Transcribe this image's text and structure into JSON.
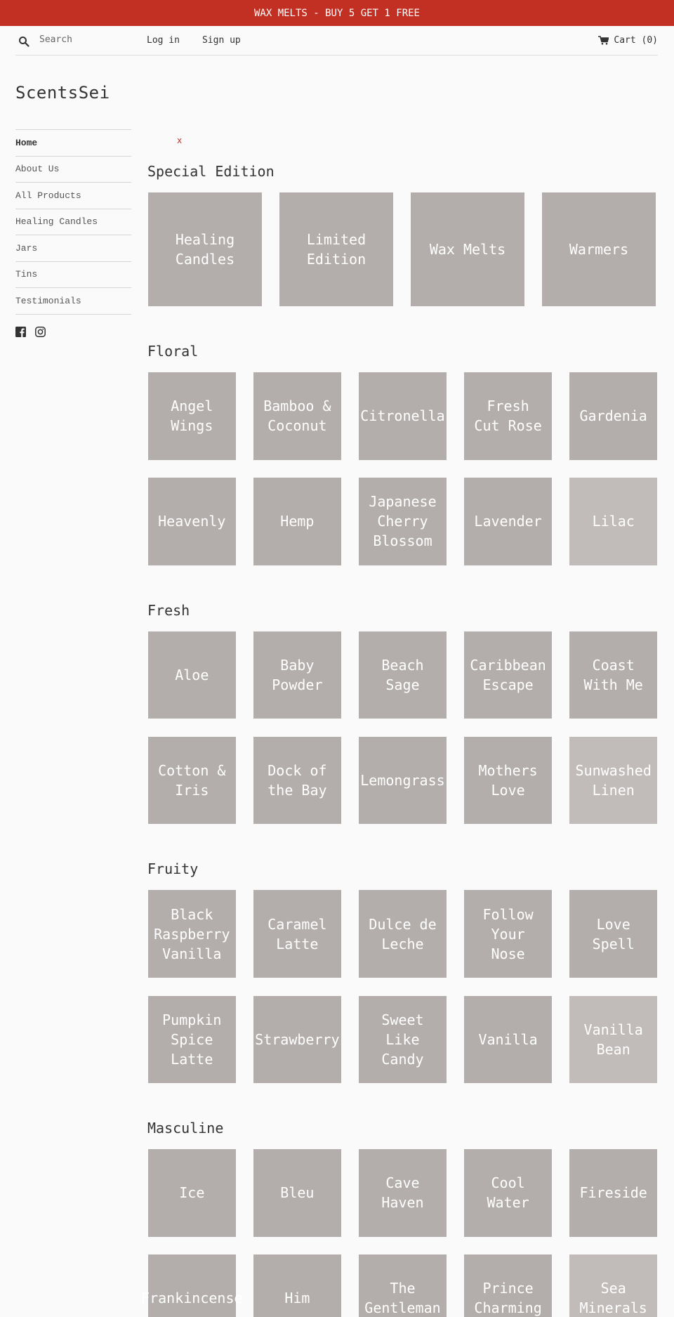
{
  "announcement": "WAX MELTS - BUY 5 GET 1 FREE",
  "header": {
    "search_placeholder": "Search",
    "login": "Log in",
    "signup": "Sign up",
    "cart": "Cart (0)"
  },
  "brand": "ScentsSei",
  "sidebar": {
    "items": [
      {
        "label": "Home",
        "active": true
      },
      {
        "label": "About Us"
      },
      {
        "label": "All Products"
      },
      {
        "label": "Healing Candles"
      },
      {
        "label": "Jars"
      },
      {
        "label": "Tins"
      },
      {
        "label": "Testimonials"
      }
    ],
    "social": [
      "facebook-icon",
      "instagram-icon"
    ]
  },
  "close_mark": "x",
  "sections": [
    {
      "title": "Special Edition",
      "items": [
        "Healing\nCandles",
        "Limited\nEdition",
        "Wax Melts",
        "Warmers"
      ]
    },
    {
      "title": "Floral",
      "items": [
        "Angel\nWings",
        "Bamboo &\nCoconut",
        "Citronella",
        "Fresh\nCut Rose",
        "Gardenia",
        "Heavenly",
        "Hemp",
        "Japanese\nCherry\nBlossom",
        "Lavender",
        "Lilac"
      ]
    },
    {
      "title": "Fresh",
      "items": [
        "Aloe",
        "Baby\nPowder",
        "Beach\nSage",
        "Caribbean\nEscape",
        "Coast\nWith Me",
        "Cotton &\nIris",
        "Dock of\nthe Bay",
        "Lemongrass",
        "Mothers\nLove",
        "Sunwashed\nLinen"
      ]
    },
    {
      "title": "Fruity",
      "items": [
        "Black\nRaspberry\nVanilla",
        "Caramel\nLatte",
        "Dulce de\nLeche",
        "Follow\nYour\nNose",
        "Love\nSpell",
        "Pumpkin\nSpice\nLatte",
        "Strawberry",
        "Sweet\nLike\nCandy",
        "Vanilla",
        "Vanilla\nBean"
      ]
    },
    {
      "title": "Masculine",
      "items": [
        "Ice",
        "Bleu",
        "Cave\nHaven",
        "Cool\nWater",
        "Fireside",
        "Frankincense",
        "Him",
        "The\nGentleman",
        "Prince\nCharming",
        "Sea\nMinerals"
      ]
    }
  ],
  "colors": {
    "accent": "#c23023",
    "tile": "#b3aeac",
    "tile_light": "#c1bcba",
    "background": "#fafafa"
  }
}
